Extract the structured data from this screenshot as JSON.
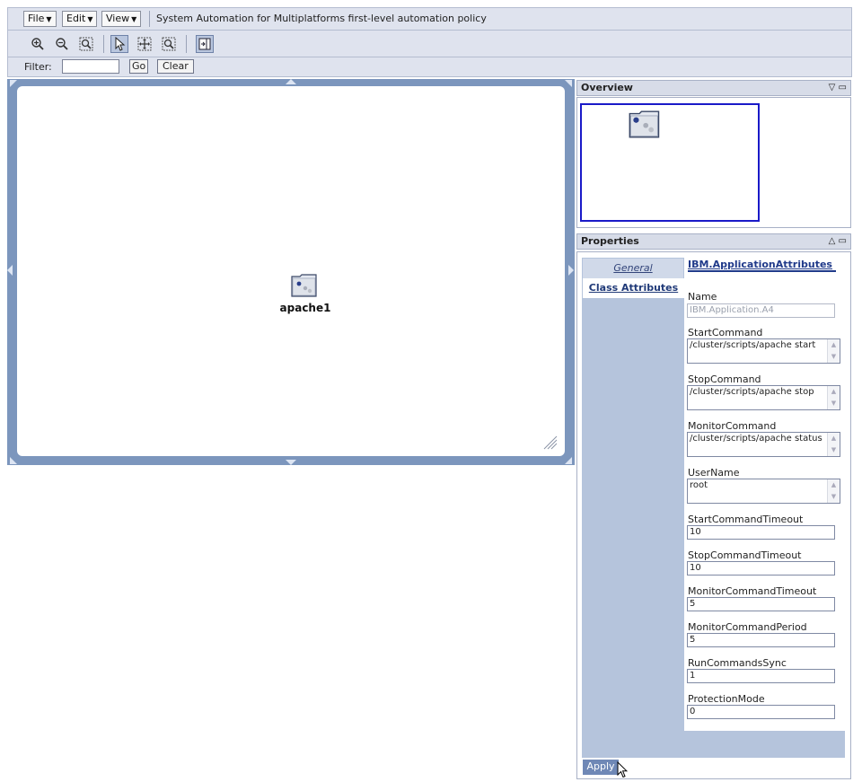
{
  "header": {
    "menus": [
      {
        "label": "File"
      },
      {
        "label": "Edit"
      },
      {
        "label": "View"
      }
    ],
    "title": "System Automation for Multiplatforms first-level automation policy"
  },
  "toolbar": {
    "tools": [
      {
        "icon": "zoom-in-icon"
      },
      {
        "icon": "zoom-out-icon"
      },
      {
        "icon": "zoom-fit-icon"
      },
      {
        "icon": "select-pointer-icon",
        "active": true
      },
      {
        "icon": "pan-icon"
      },
      {
        "icon": "marquee-zoom-icon"
      },
      {
        "icon": "fit-panel-icon",
        "active": true
      }
    ]
  },
  "filter": {
    "label": "Filter:",
    "value": "",
    "go_label": "Go",
    "clear_label": "Clear"
  },
  "canvas": {
    "node_label": "apache1"
  },
  "overview": {
    "title": "Overview"
  },
  "properties": {
    "title": "Properties",
    "tabs": [
      {
        "label": "General"
      },
      {
        "label": "Class Attributes"
      }
    ],
    "section_title": "IBM.ApplicationAttributes",
    "fields": {
      "name": {
        "label": "Name",
        "value": "IBM.Application.A4"
      },
      "start_command": {
        "label": "StartCommand",
        "value": "/cluster/scripts/apache start"
      },
      "stop_command": {
        "label": "StopCommand",
        "value": "/cluster/scripts/apache stop"
      },
      "monitor_command": {
        "label": "MonitorCommand",
        "value": "/cluster/scripts/apache status"
      },
      "user_name": {
        "label": "UserName",
        "value": "root"
      },
      "start_timeout": {
        "label": "StartCommandTimeout",
        "value": "10"
      },
      "stop_timeout": {
        "label": "StopCommandTimeout",
        "value": "10"
      },
      "monitor_timeout": {
        "label": "MonitorCommandTimeout",
        "value": "5"
      },
      "monitor_period": {
        "label": "MonitorCommandPeriod",
        "value": "5"
      },
      "run_sync": {
        "label": "RunCommandsSync",
        "value": "1"
      },
      "protection_mode": {
        "label": "ProtectionMode",
        "value": "0"
      }
    },
    "apply_label": "Apply"
  }
}
